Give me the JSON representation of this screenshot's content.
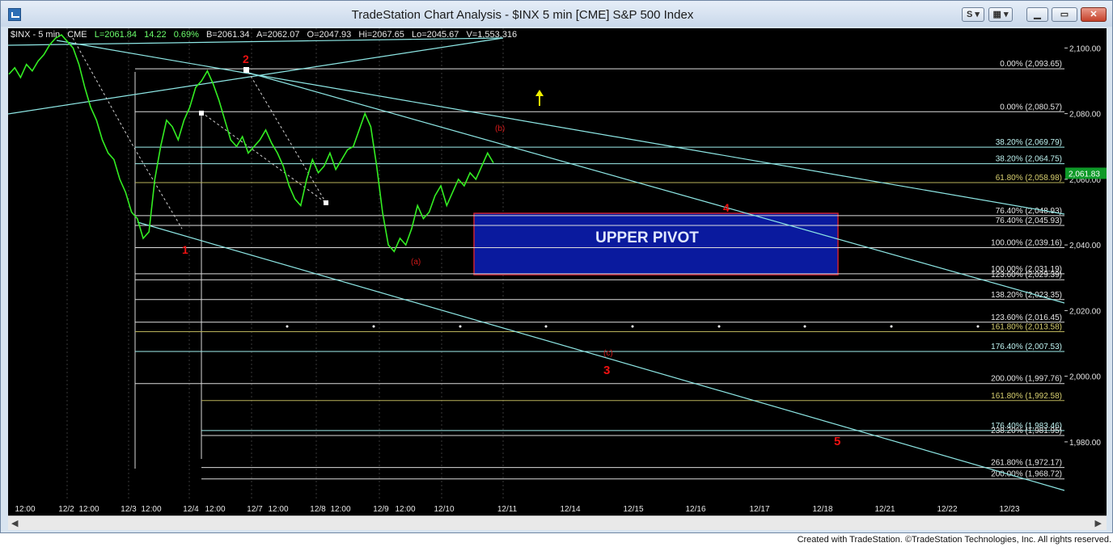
{
  "window": {
    "title": "TradeStation Chart Analysis - $INX 5 min [CME] S&P 500 Index",
    "footer": "Created with TradeStation. ©TradeStation Technologies, Inc. All rights reserved."
  },
  "toolbar": {
    "s_label": "S",
    "grid_label": "▦"
  },
  "info_line": {
    "symbol": "$INX - 5 min",
    "exchange": "CME",
    "last": "L=2061.84",
    "change": "14.22",
    "pct": "0.69%",
    "bid": "B=2061.34",
    "ask": "A=2062.07",
    "open": "O=2047.93",
    "high": "Hi=2067.65",
    "low": "Lo=2045.67",
    "volume": "V=1,553,316"
  },
  "colors": {
    "price": "#33ee22",
    "cyan": "#9ff0ee",
    "fib_white": "#e6e6e6",
    "pivot_fill": "#0a1a9e",
    "pivot_border": "#cc2233",
    "wave_red": "#ee1111",
    "arrow": "#f0f000",
    "last_badge": "#0e9a28"
  },
  "chart_data": {
    "type": "line",
    "title": "$INX 5 min [CME] S&P 500 Index",
    "ylim": [
      1962,
      2106
    ],
    "y_ticks": [
      2100.0,
      2080.0,
      2060.0,
      2040.0,
      2020.0,
      2000.0,
      1980.0
    ],
    "y_tick_labels": [
      "2,100.00",
      "2,080.00",
      "2,060.00",
      "2,040.00",
      "2,020.00",
      "2,000.00",
      "1,980.00"
    ],
    "last_price_label": "2,061.83",
    "last_price": 2061.83,
    "x_tick_labels": [
      "12:00",
      "12/2",
      "12:00",
      "12/3",
      "12:00",
      "12/4",
      "12:00",
      "12/7",
      "12:00",
      "12/8",
      "12:00",
      "12/9",
      "12:00",
      "12/10",
      "12/11",
      "12/14",
      "12/15",
      "12/16",
      "12/17",
      "12/18",
      "12/21",
      "12/22",
      "12/23"
    ],
    "series": [
      {
        "values": [
          2092,
          2094,
          2091,
          2095,
          2093,
          2096,
          2098,
          2101,
          2103,
          2104,
          2102,
          2100,
          2095,
          2088,
          2082,
          2078,
          2072,
          2068,
          2066,
          2060,
          2056,
          2050,
          2048,
          2042,
          2044,
          2060,
          2070,
          2078,
          2076,
          2072,
          2078,
          2082,
          2088,
          2090,
          2093,
          2089,
          2084,
          2078,
          2072,
          2070,
          2073,
          2068,
          2070,
          2072,
          2075,
          2071,
          2068,
          2064,
          2058,
          2054,
          2052,
          2060,
          2066,
          2062,
          2064,
          2068,
          2063,
          2066,
          2069,
          2070,
          2075,
          2080,
          2076,
          2064,
          2050,
          2040,
          2038,
          2042,
          2040,
          2045,
          2052,
          2048,
          2050,
          2055,
          2058,
          2052,
          2056,
          2060,
          2058,
          2062,
          2060,
          2064,
          2068,
          2065
        ]
      }
    ],
    "fib_levels": [
      {
        "label": "0.00% (2,093.65)",
        "value": 2093.65
      },
      {
        "label": "0.00% (2,080.57)",
        "value": 2080.57
      },
      {
        "label": "38.20% (2,069.79)",
        "value": 2069.79
      },
      {
        "label": "38.20% (2,064.75)",
        "value": 2064.75
      },
      {
        "label": "61.80% (2,058.98)",
        "value": 2058.98
      },
      {
        "label": "76.40% (2,048.93)",
        "value": 2048.93
      },
      {
        "label": "76.40% (2,045.93)",
        "value": 2045.93
      },
      {
        "label": "100.00% (2,039.16)",
        "value": 2039.16
      },
      {
        "label": "100.00% (2,031.19)",
        "value": 2031.19
      },
      {
        "label": "123.60% (2,029.39)",
        "value": 2029.39
      },
      {
        "label": "138.20% (2,023.35)",
        "value": 2023.35
      },
      {
        "label": "123.60% (2,016.45)",
        "value": 2016.45
      },
      {
        "label": "161.80% (2,013.58)",
        "value": 2013.58
      },
      {
        "label": "176.40% (2,007.53)",
        "value": 2007.53
      },
      {
        "label": "200.00% (1,997.76)",
        "value": 1997.76
      },
      {
        "label": "161.80% (1,992.58)",
        "value": 1992.58
      },
      {
        "label": "176.40% (1,983.46)",
        "value": 1983.46
      },
      {
        "label": "238.20% (1,981.95)",
        "value": 1981.95
      },
      {
        "label": "261.80% (1,972.17)",
        "value": 1972.17
      },
      {
        "label": "200.00% (1,968.72)",
        "value": 1968.72
      }
    ],
    "annotations": {
      "pivot_label": "UPPER PIVOT",
      "waves": [
        "1",
        "2",
        "3",
        "4",
        "5"
      ],
      "sub_waves": [
        "(a)",
        "(b)",
        "(c)"
      ]
    }
  }
}
